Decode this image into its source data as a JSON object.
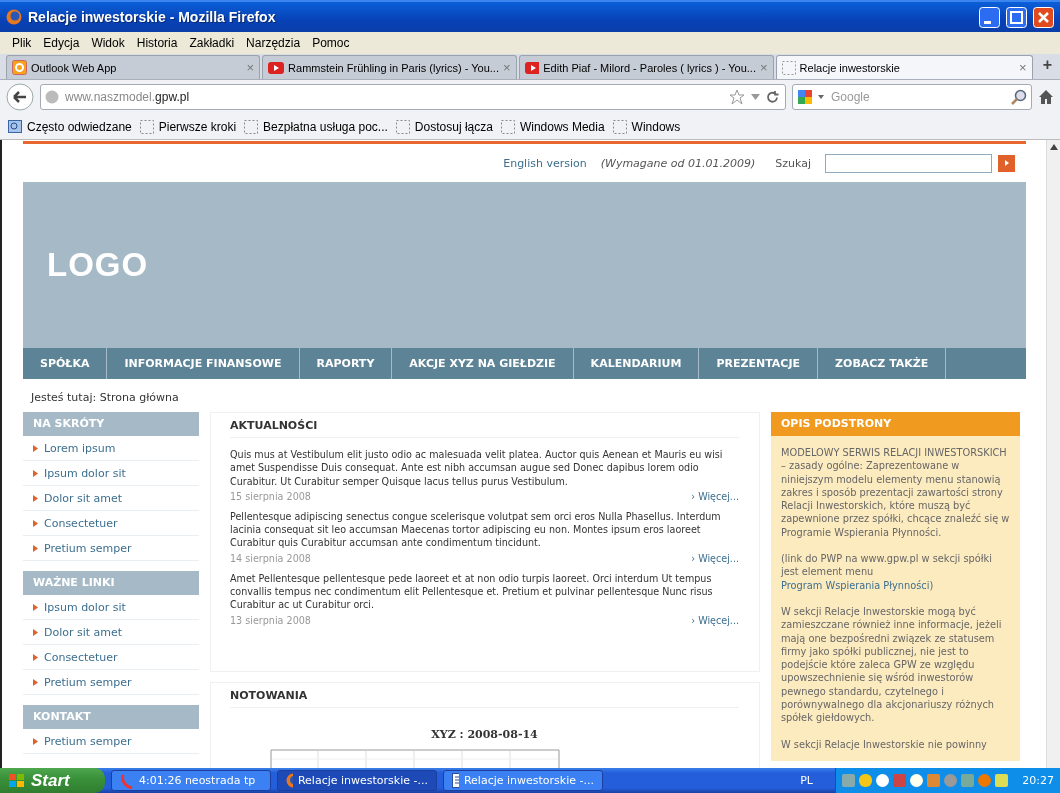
{
  "window": {
    "title": "Relacje inwestorskie - Mozilla Firefox"
  },
  "menu": [
    "Plik",
    "Edycja",
    "Widok",
    "Historia",
    "Zakładki",
    "Narzędzia",
    "Pomoc"
  ],
  "tabs": [
    {
      "label": "Outlook Web App",
      "kind": "outlook",
      "selected": false,
      "close": "×"
    },
    {
      "label": "Rammstein Frühling in Paris (lyrics) - You...",
      "kind": "video",
      "selected": false,
      "close": "×"
    },
    {
      "label": "Edith Piaf - Milord - Paroles ( lyrics ) - You...",
      "kind": "video",
      "selected": false,
      "close": "×"
    },
    {
      "label": "Relacje inwestorskie",
      "kind": "blank",
      "selected": true,
      "close": "×"
    }
  ],
  "new_tab": "+",
  "address": {
    "subdomain": "www.naszmodel.",
    "domain": "gpw.pl"
  },
  "web_search": {
    "placeholder": "Google"
  },
  "bookmarks": [
    {
      "label": "Często odwiedzane",
      "kind": "folder"
    },
    {
      "label": "Pierwsze kroki",
      "kind": "page"
    },
    {
      "label": "Bezpłatna usługa poc...",
      "kind": "page"
    },
    {
      "label": "Dostosuj łącza",
      "kind": "page"
    },
    {
      "label": "Windows Media",
      "kind": "page"
    },
    {
      "label": "Windows",
      "kind": "page"
    }
  ],
  "page": {
    "english_link": "English version",
    "note": "(Wymagane od 01.01.2009)",
    "search_label": "Szukaj",
    "logo": "LOGO",
    "nav": [
      "SPÓŁKA",
      "INFORMACJE FINANSOWE",
      "RAPORTY",
      "AKCJE XYZ NA GIEŁDZIE",
      "KALENDARIUM",
      "PREZENTACJE",
      "ZOBACZ TAKŻE"
    ],
    "breadcrumb": "Jesteś tutaj: Strona główna",
    "sidebar": [
      {
        "title": "NA SKRÓTY",
        "items": [
          "Lorem ipsum",
          "Ipsum dolor sit",
          "Dolor sit amet",
          "Consectetuer",
          "Pretium semper"
        ]
      },
      {
        "title": "WAŻNE LINKI",
        "items": [
          "Ipsum dolor sit",
          "Dolor sit amet",
          "Consectetuer",
          "Pretium semper"
        ]
      },
      {
        "title": "KONTAKT",
        "items": [
          "Pretium semper"
        ]
      }
    ],
    "news": {
      "title": "AKTUALNOŚCI",
      "items": [
        {
          "text": "Quis mus at Vestibulum elit justo odio ac malesuada velit platea. Auctor quis Aenean et Mauris eu wisi amet Suspendisse Duis consequat. Ante est nibh accumsan augue sed Donec dapibus lorem odio Curabitur. Ut Curabitur semper Quisque lacus tellus purus Vestibulum.",
          "date": "15 sierpnia 2008",
          "more": "› Więcej..."
        },
        {
          "text": "Pellentesque adipiscing senectus congue scelerisque volutpat sem orci eros Nulla Phasellus. Interdum lacinia consequat sit leo accumsan Maecenas tortor adipiscing eu non. Montes ipsum eros laoreet Curabitur quis Curabitur accumsan ante condimentum tincidunt.",
          "date": "14 sierpnia 2008",
          "more": "› Więcej..."
        },
        {
          "text": "Amet Pellentesque pellentesque pede laoreet et at non odio turpis laoreet. Orci interdum Ut tempus convallis tempus nec condimentum elit Pellentesque et. Pretium et pulvinar pellentesque Nunc risus Curabitur ac ut Curabitur orci.",
          "date": "13 sierpnia 2008",
          "more": "› Więcej..."
        }
      ]
    },
    "quotes": {
      "title": "NOTOWANIA",
      "chart_title": "XYZ : 2008-08-14"
    },
    "description": {
      "title": "OPIS PODSTRONY",
      "paragraphs": [
        {
          "text": "MODELOWY SERWIS RELACJI INWESTORSKICH – zasady ogólne: Zaprezentowane w niniejszym modelu elementy menu stanowią zakres i sposób prezentacji zawartości strony Relacji Inwestorskich, które muszą być zapewnione przez spółki, chcące znaleźć się w Programie Wspierania Płynności."
        },
        {
          "text": "(link do PWP na www.gpw.pl w sekcji spółki jest element menu ",
          "link": "Program Wspierania Płynności",
          "after": ")"
        },
        {
          "text": "W sekcji Relacje Inwestorskie mogą być zamieszczane również inne informacje, jeżeli mają one bezpośredni związek ze statusem firmy jako spółki publicznej, nie jest to podejście które zaleca GPW ze względu upowszechnienie się wśród inwestorów pewnego standardu, czytelnego i porównywalnego dla akcjonariuszy różnych spółek giełdowych."
        },
        {
          "text": "W sekcji Relacje Inwestorskie nie powinny"
        }
      ]
    }
  },
  "taskbar": {
    "start": "Start",
    "tasks": [
      {
        "label": "4:01:26 neostrada tp",
        "kind": "dialer",
        "selected": false
      },
      {
        "label": "Relacje inwestorskie -...",
        "kind": "browser",
        "selected": true
      },
      {
        "label": "Relacje inwestorskie -...",
        "kind": "document",
        "selected": false
      }
    ],
    "language": "PL",
    "clock": "20:27"
  }
}
